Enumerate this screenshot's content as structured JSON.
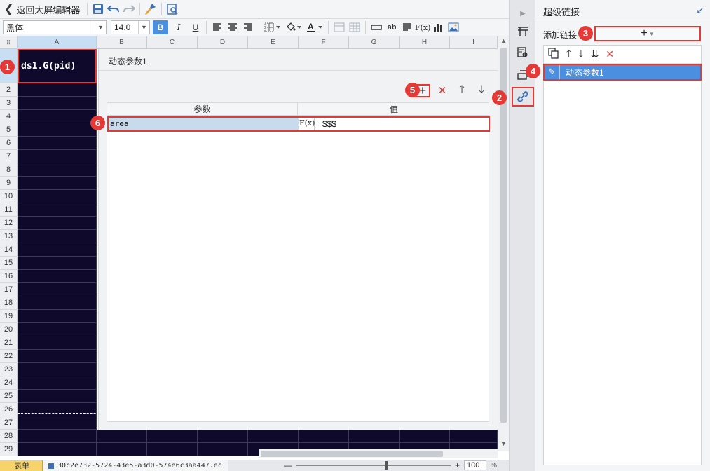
{
  "toolbar": {
    "back_label": "返回大屏编辑器",
    "font_family": "黑体",
    "font_size": "14.0",
    "bold": "B",
    "italic": "I",
    "underline": "U",
    "text_ab": "ab",
    "fx": "F(x)"
  },
  "sheet": {
    "columns": [
      "A",
      "B",
      "C",
      "D",
      "E",
      "F",
      "G",
      "H",
      "I"
    ],
    "rows": [
      "1",
      "2",
      "3",
      "4",
      "5",
      "6",
      "7",
      "8",
      "9",
      "10",
      "11",
      "12",
      "13",
      "14",
      "15",
      "16",
      "17",
      "18",
      "19",
      "20",
      "21",
      "22",
      "23",
      "24",
      "25",
      "26",
      "27",
      "28",
      "29"
    ],
    "cell_A1": "ds1.G(pid)"
  },
  "hyperlink_editor": {
    "title": "动态参数1",
    "table_headers": {
      "param": "参数",
      "value": "值"
    },
    "rows": [
      {
        "name": "area",
        "fx": "F(x)",
        "value": "=$$$"
      }
    ]
  },
  "statusbar": {
    "sheet_tab": "表单",
    "file_name": "30c2e732-5724-43e5-a3d0-574e6c3aa447.ec",
    "zoom_minus": "—",
    "zoom_plus": "+",
    "zoom_value": "100",
    "zoom_unit": "%"
  },
  "right_panel": {
    "title": "超级链接",
    "add_link_label": "添加链接",
    "add_button": "+",
    "links": [
      {
        "label": "动态参数1"
      }
    ]
  },
  "markers": [
    "1",
    "2",
    "3",
    "4",
    "5",
    "6"
  ],
  "colors": {
    "highlight_red": "#e53935",
    "selected_blue": "#4a8fe0",
    "cell_dark": "#0f0a2b"
  }
}
